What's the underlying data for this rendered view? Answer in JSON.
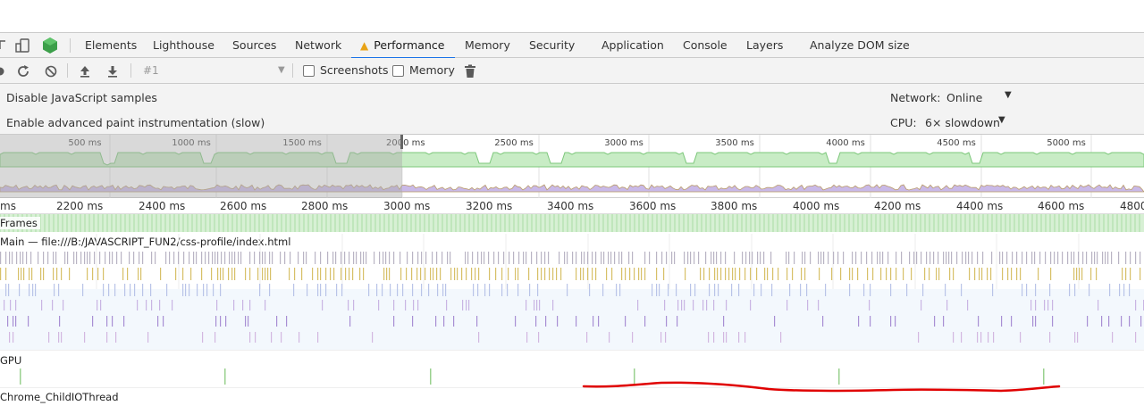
{
  "toolbar_tabs": {
    "elements": "Elements",
    "lighthouse": "Lighthouse",
    "sources": "Sources",
    "network": "Network",
    "performance": "Performance",
    "memory": "Memory",
    "security": "Security",
    "application": "Application",
    "console": "Console",
    "layers": "Layers",
    "analyze_dom": "Analyze DOM size"
  },
  "perf_toolbar": {
    "recording_select": "#1",
    "screenshots_label": "Screenshots",
    "memory_label": "Memory"
  },
  "settings": {
    "disable_js": "Disable JavaScript samples",
    "paint_instr": "Enable advanced paint instrumentation (slow)",
    "network_label": "Network:",
    "network_value": "Online",
    "cpu_label": "CPU:",
    "cpu_value": "6× slowdown"
  },
  "overview_ticks": [
    "500 ms",
    "1000 ms",
    "1500 ms",
    "2000 ms",
    "2500 ms",
    "3000 ms",
    "3500 ms",
    "4000 ms",
    "4500 ms",
    "5000 ms"
  ],
  "ruler_ticks": [
    "ms",
    "2200 ms",
    "2400 ms",
    "2600 ms",
    "2800 ms",
    "3000 ms",
    "3200 ms",
    "3400 ms",
    "3600 ms",
    "3800 ms",
    "4000 ms",
    "4200 ms",
    "4400 ms",
    "4600 ms",
    "4800"
  ],
  "tracks": {
    "frames": "Frames",
    "main": "Main — file:///B:/JAVASCRIPT_FUN2/css-profile/index.html",
    "gpu": "GPU",
    "io": "Chrome_ChildIOThread"
  },
  "colors": {
    "accent": "#1a73e8",
    "frames_green": "#c8ecc5",
    "annotation_red": "#e00000"
  }
}
